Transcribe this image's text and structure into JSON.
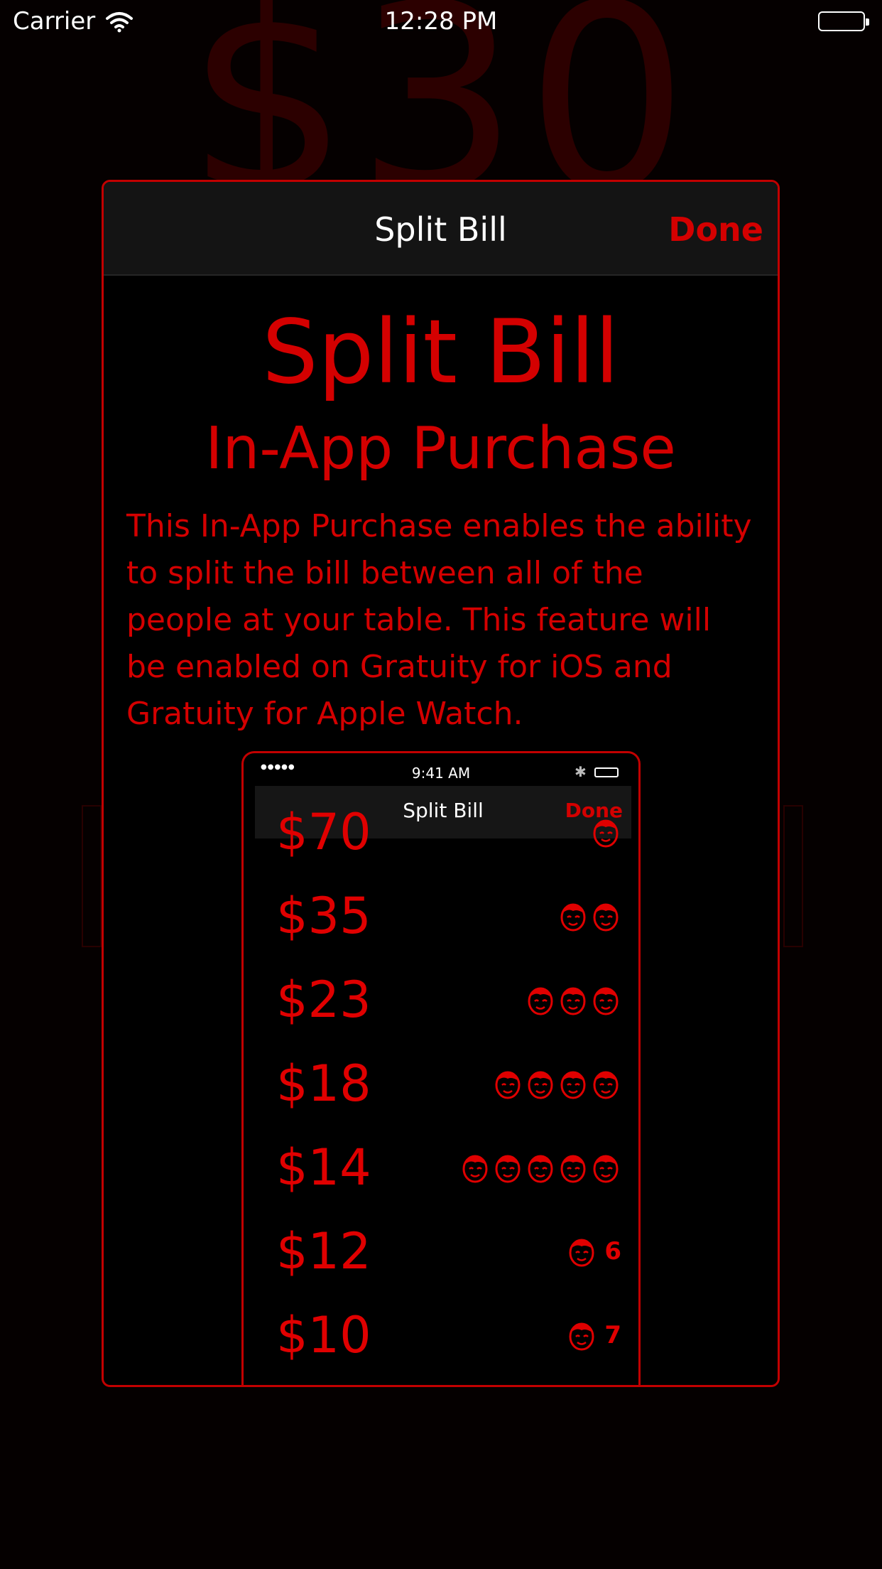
{
  "background": {
    "amount_text": "$30"
  },
  "status_bar": {
    "carrier": "Carrier",
    "time": "12:28 PM"
  },
  "modal": {
    "nav_title": "Split Bill",
    "done_label": "Done",
    "heading": "Split Bill",
    "subheading": "In-App Purchase",
    "description": "This In-App Purchase enables the ability to split the bill between all of the people at your table. This feature will be enabled on Gratuity for iOS and Gratuity for Apple Watch."
  },
  "preview": {
    "status_time": "9:41 AM",
    "nav_title": "Split Bill",
    "done_label": "Done",
    "rows": [
      {
        "amount": "$70",
        "people": 1,
        "count_label": ""
      },
      {
        "amount": "$35",
        "people": 2,
        "count_label": ""
      },
      {
        "amount": "$23",
        "people": 3,
        "count_label": ""
      },
      {
        "amount": "$18",
        "people": 4,
        "count_label": ""
      },
      {
        "amount": "$14",
        "people": 5,
        "count_label": ""
      },
      {
        "amount": "$12",
        "people": 1,
        "count_label": "6"
      },
      {
        "amount": "$10",
        "people": 1,
        "count_label": "7"
      }
    ]
  },
  "colors": {
    "accent": "#d40000",
    "background": "#050000",
    "nav_bg": "#141414"
  },
  "icons": {
    "person": "face-icon",
    "wifi": "wifi-icon",
    "battery": "battery-icon",
    "bluetooth": "bluetooth-icon"
  }
}
